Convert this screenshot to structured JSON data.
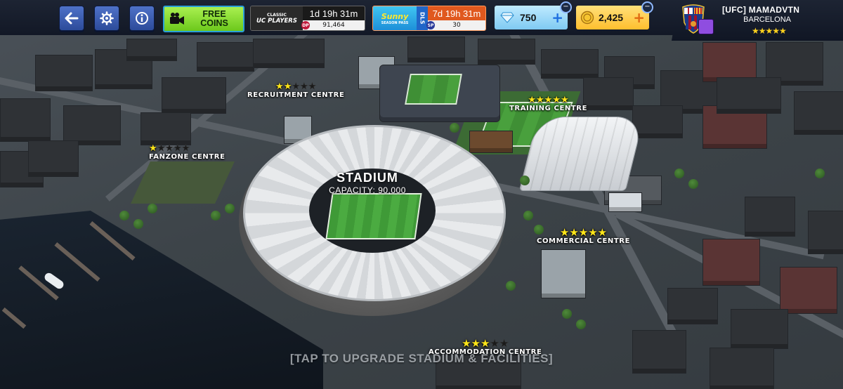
{
  "topbar": {
    "back_icon": "back-arrow-icon",
    "settings_icon": "gear-icon",
    "info_icon": "info-icon",
    "free_coins": {
      "line1": "FREE",
      "line2": "COINS"
    },
    "events": [
      {
        "logo_line1": "CLASSIC",
        "logo_line2": "UC PLAYERS",
        "time": "1d 19h 31m",
        "badge": "DP",
        "points": "91,464"
      },
      {
        "logo_line1": "Sunny",
        "logo_line2": "SEASON PASS",
        "tag": "DLS",
        "time": "7d 19h 31m",
        "badge": "SP",
        "points": "30"
      }
    ],
    "gems": {
      "value": "750",
      "plus": "+",
      "minus": "−"
    },
    "coins": {
      "value": "2,425",
      "plus": "+",
      "minus": "−"
    }
  },
  "profile": {
    "name": "[UFC] MAMADVTN",
    "club": "BARCELONA",
    "stars": "★★★★★"
  },
  "stadium": {
    "title": "STADIUM",
    "capacity": "CAPACITY: 90,000"
  },
  "facilities": {
    "recruitment": {
      "label": "RECRUITMENT CENTRE",
      "stars_on": "★★",
      "stars_off": "★★★"
    },
    "training": {
      "label": "TRAINING CENTRE",
      "stars_on": "★★★★★",
      "stars_off": ""
    },
    "fanzone": {
      "label": "FANZONE CENTRE",
      "stars_on": "★",
      "stars_off": "★★★★"
    },
    "commercial": {
      "label": "COMMERCIAL CENTRE",
      "stars_on": "★★★★★",
      "stars_off": ""
    },
    "accommodation": {
      "label": "ACCOMMODATION CENTRE",
      "stars_on": "★★★",
      "stars_off": "★★"
    }
  },
  "hint": "[TAP TO UPGRADE STADIUM & FACILITIES]",
  "colors": {
    "accent_green": "#7dd62a",
    "gem_blue": "#8fd8ff",
    "coin_gold": "#ffc93a",
    "star_yellow": "#ffe61a"
  }
}
